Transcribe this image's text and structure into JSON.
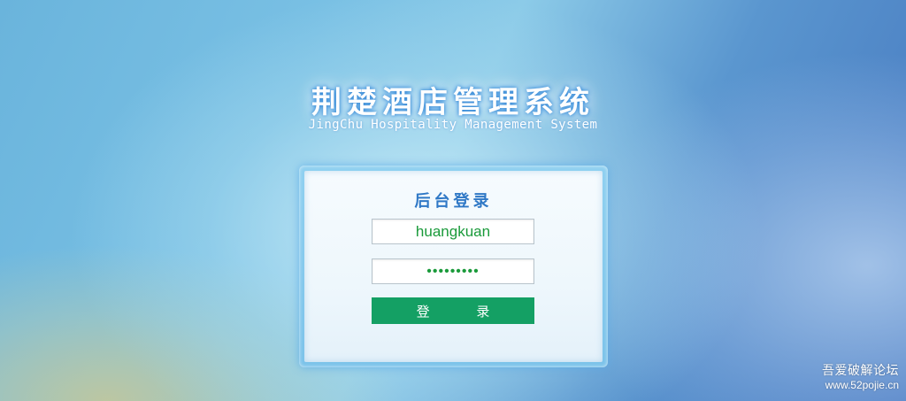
{
  "header": {
    "title_cn": "荆楚酒店管理系统",
    "title_en": "JingChu Hospitality Management System"
  },
  "login": {
    "heading": "后台登录",
    "username_value": "huangkuan",
    "password_value": "•••••••••",
    "submit_label": "登 录"
  },
  "watermark": {
    "site_name": "吾爱破解论坛",
    "site_url": "www.52pojie.cn"
  },
  "colors": {
    "accent_blue": "#2f78c6",
    "button_green": "#14a064",
    "input_text_green": "#1a9a3a"
  }
}
